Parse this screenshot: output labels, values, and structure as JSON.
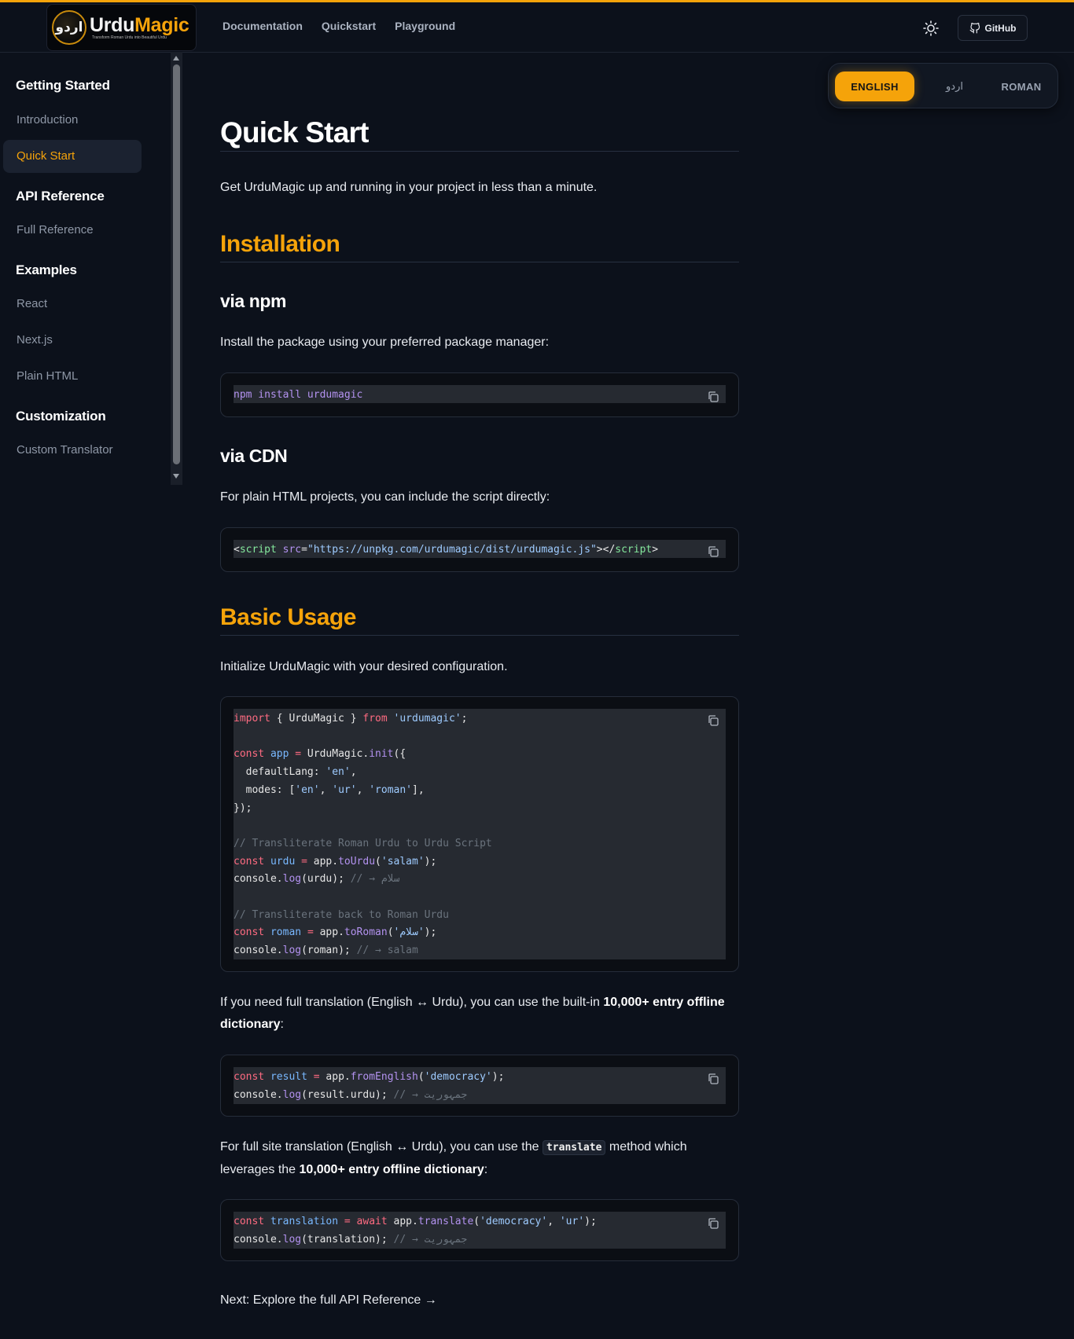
{
  "header": {
    "logo": {
      "mark": "اردو",
      "name_part1": "Urdu",
      "name_part2": "Magic",
      "tagline": "Transform Roman Urdu into Beautiful Urdu"
    },
    "nav": [
      "Documentation",
      "Quickstart",
      "Playground"
    ],
    "theme_icon": "sun-icon",
    "github_label": "GitHub",
    "accent": "#f5a30a"
  },
  "sidebar": {
    "groups": [
      {
        "title": "Getting Started",
        "items": [
          "Introduction",
          "Quick Start"
        ]
      },
      {
        "title": "API Reference",
        "items": [
          "Full Reference"
        ]
      },
      {
        "title": "Examples",
        "items": [
          "React",
          "Next.js",
          "Plain HTML"
        ]
      },
      {
        "title": "Customization",
        "items": [
          "Custom Translator"
        ]
      }
    ],
    "active_item": "Quick Start"
  },
  "lang_switch": {
    "options": [
      "ENGLISH",
      "اردو",
      "ROMAN"
    ],
    "selected": "ENGLISH"
  },
  "content": {
    "title": "Quick Start",
    "intro": "Get UrduMagic up and running in your project in less than a minute.",
    "installation": {
      "heading": "Installation",
      "npm_heading": "via npm",
      "npm_text": "Install the package using your preferred package manager:",
      "npm_code": "npm install urdumagic",
      "cdn_heading": "via CDN",
      "cdn_text": "For plain HTML projects, you can include the script directly:",
      "cdn_code": {
        "open_tag": "script",
        "attr": "src",
        "url": "\"https://unpkg.com/urdumagic/dist/urdumagic.js\"",
        "close_tag": "script"
      }
    },
    "basic_usage": {
      "heading": "Basic Usage",
      "text": "Initialize UrduMagic with your desired configuration.",
      "code_lines": [
        "import { UrduMagic } from 'urdumagic';",
        "",
        "const app = UrduMagic.init({",
        "  defaultLang: 'en',",
        "  modes: ['en', 'ur', 'roman'],",
        "});",
        "",
        "// Transliterate Roman Urdu to Urdu Script",
        "const urdu = app.toUrdu('salam');",
        "console.log(urdu); // → سلام",
        "",
        "// Transliterate back to Roman Urdu",
        "const roman = app.toRoman('سلام');",
        "console.log(roman); // → salam"
      ]
    },
    "translation": {
      "text_before": "If you need full translation (English ↔ Urdu), you can use the built-in ",
      "text_strong": "10,000+ entry offline dictionary",
      "text_after": ":",
      "code_lines": [
        "const result = app.fromEnglish('democracy');",
        "console.log(result.urdu); // → جمہوریت"
      ]
    },
    "site_translation": {
      "text_before": "For full site translation (English ↔ Urdu), you can use the ",
      "inline_code": "translate",
      "text_middle": " method which leverages the ",
      "text_strong": "10,000+ entry offline dictionary",
      "text_after": ":",
      "code_lines": [
        "const translation = await app.translate('democracy', 'ur');",
        "console.log(translation); // → جمہوریت"
      ]
    },
    "next_link": "Next: Explore the full API Reference →"
  }
}
